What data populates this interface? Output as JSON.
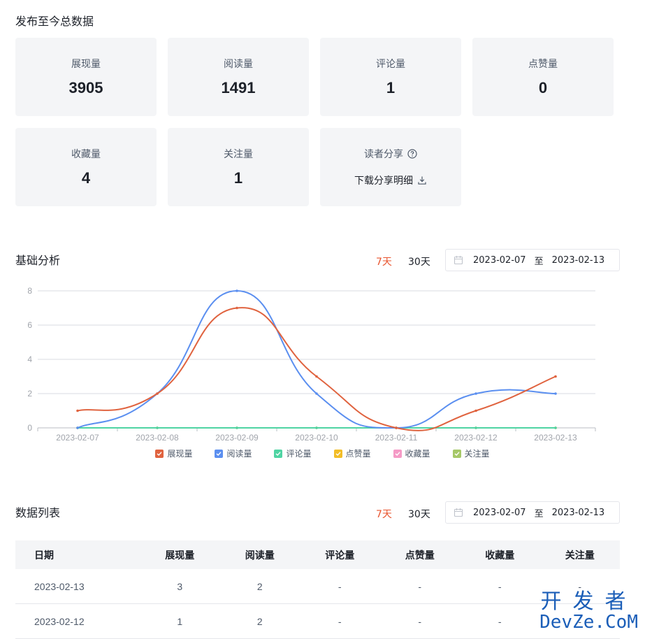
{
  "summary": {
    "title": "发布至今总数据",
    "cards": [
      {
        "label": "展现量",
        "value": "3905"
      },
      {
        "label": "阅读量",
        "value": "1491"
      },
      {
        "label": "评论量",
        "value": "1"
      },
      {
        "label": "点赞量",
        "value": "0"
      },
      {
        "label": "收藏量",
        "value": "4"
      },
      {
        "label": "关注量",
        "value": "1"
      }
    ],
    "share_card": {
      "label": "读者分享",
      "download_label": "下载分享明细"
    }
  },
  "analysis": {
    "title": "基础分析",
    "tab_7d": "7天",
    "tab_30d": "30天",
    "date_from": "2023-02-07",
    "date_sep": "至",
    "date_to": "2023-02-13"
  },
  "chart_data": {
    "type": "line",
    "x": [
      "2023-02-07",
      "2023-02-08",
      "2023-02-09",
      "2023-02-10",
      "2023-02-11",
      "2023-02-12",
      "2023-02-13"
    ],
    "ylim": [
      0,
      8
    ],
    "yticks": [
      0,
      2,
      4,
      6,
      8
    ],
    "grid": true,
    "legend_position": "bottom",
    "series": [
      {
        "name": "展现量",
        "color": "#e0633f",
        "values": [
          1,
          2,
          7,
          3,
          0,
          1,
          3
        ]
      },
      {
        "name": "阅读量",
        "color": "#5b8ff0",
        "values": [
          0,
          2,
          8,
          2,
          0,
          2,
          2
        ]
      },
      {
        "name": "评论量",
        "color": "#4fd4a3",
        "values": [
          0,
          0,
          0,
          0,
          0,
          0,
          0
        ]
      },
      {
        "name": "点赞量",
        "color": "#f2bd27",
        "values": [
          0,
          0,
          0,
          0,
          0,
          0,
          0
        ]
      },
      {
        "name": "收藏量",
        "color": "#f59ac6",
        "values": [
          0,
          0,
          0,
          0,
          0,
          0,
          0
        ]
      },
      {
        "name": "关注量",
        "color": "#a6c868",
        "values": [
          0,
          0,
          0,
          0,
          0,
          0,
          0
        ]
      }
    ]
  },
  "list": {
    "title": "数据列表",
    "tab_7d": "7天",
    "tab_30d": "30天",
    "date_from": "2023-02-07",
    "date_sep": "至",
    "date_to": "2023-02-13",
    "columns": [
      "日期",
      "展现量",
      "阅读量",
      "评论量",
      "点赞量",
      "收藏量",
      "关注量"
    ],
    "rows": [
      [
        "2023-02-13",
        "3",
        "2",
        "-",
        "-",
        "-",
        "-"
      ],
      [
        "2023-02-12",
        "1",
        "2",
        "-",
        "-",
        "-",
        "-"
      ]
    ]
  },
  "watermark": {
    "line1": "开发者",
    "line2": "DevZe.CoM"
  }
}
